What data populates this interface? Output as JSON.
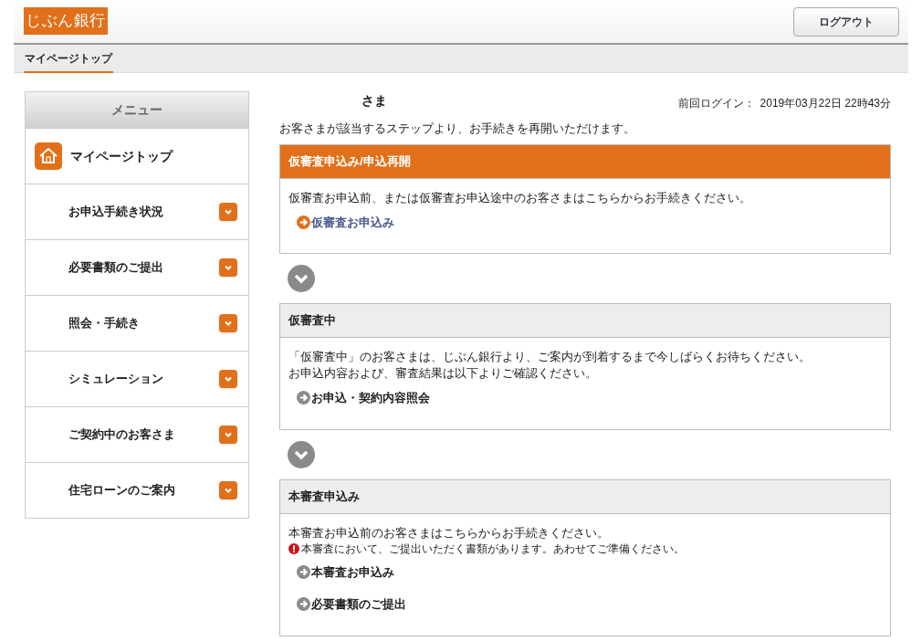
{
  "header": {
    "logo": "じぶん銀行",
    "logout": "ログアウト"
  },
  "nav": {
    "tabs": [
      {
        "label": "マイページトップ",
        "selected": true
      }
    ]
  },
  "sidebar": {
    "title": "メニュー",
    "home": "マイページトップ",
    "items": [
      {
        "label": "お申込手続き状況",
        "expanded": false
      },
      {
        "label": "必要書類のご提出",
        "expanded": false
      },
      {
        "label": "照会・手続き",
        "expanded": false
      },
      {
        "label": "シミュレーション",
        "expanded": false
      },
      {
        "label": "ご契約中のお客さま",
        "expanded": false
      },
      {
        "label": "住宅ローンのご案内",
        "expanded": false
      }
    ]
  },
  "main": {
    "customer": "さま",
    "last_login_label": "前回ログイン：",
    "last_login": "2019年03月22日 22時43分",
    "intro": "お客さまが該当するステップより、お手続きを再開いただけます。",
    "steps": [
      {
        "kind": "current",
        "title": "仮審査申込み/申込再開",
        "text": [
          "仮審査お申込前、または仮審査お申込途中のお客さまはこちらからお手続きください。"
        ],
        "links": [
          "仮審査お申込み"
        ]
      },
      {
        "kind": "normal",
        "title": "仮審査中",
        "text": [
          "「仮審査中」のお客さまは、じぶん銀行より、ご案内が到着するまで今しばらくお待ちください。",
          "お申込内容および、審査結果は以下よりご確認ください。"
        ],
        "links": [
          "お申込・契約内容照会"
        ]
      },
      {
        "kind": "normal",
        "title": "本審査申込み",
        "text": [
          "本審査お申込前のお客さまはこちらからお手続きください。"
        ],
        "notice": "本審査において、ご提出いただく書類があります。あわせてご準備ください。",
        "links": [
          "本審査お申込み",
          "必要書類のご提出"
        ]
      }
    ]
  }
}
